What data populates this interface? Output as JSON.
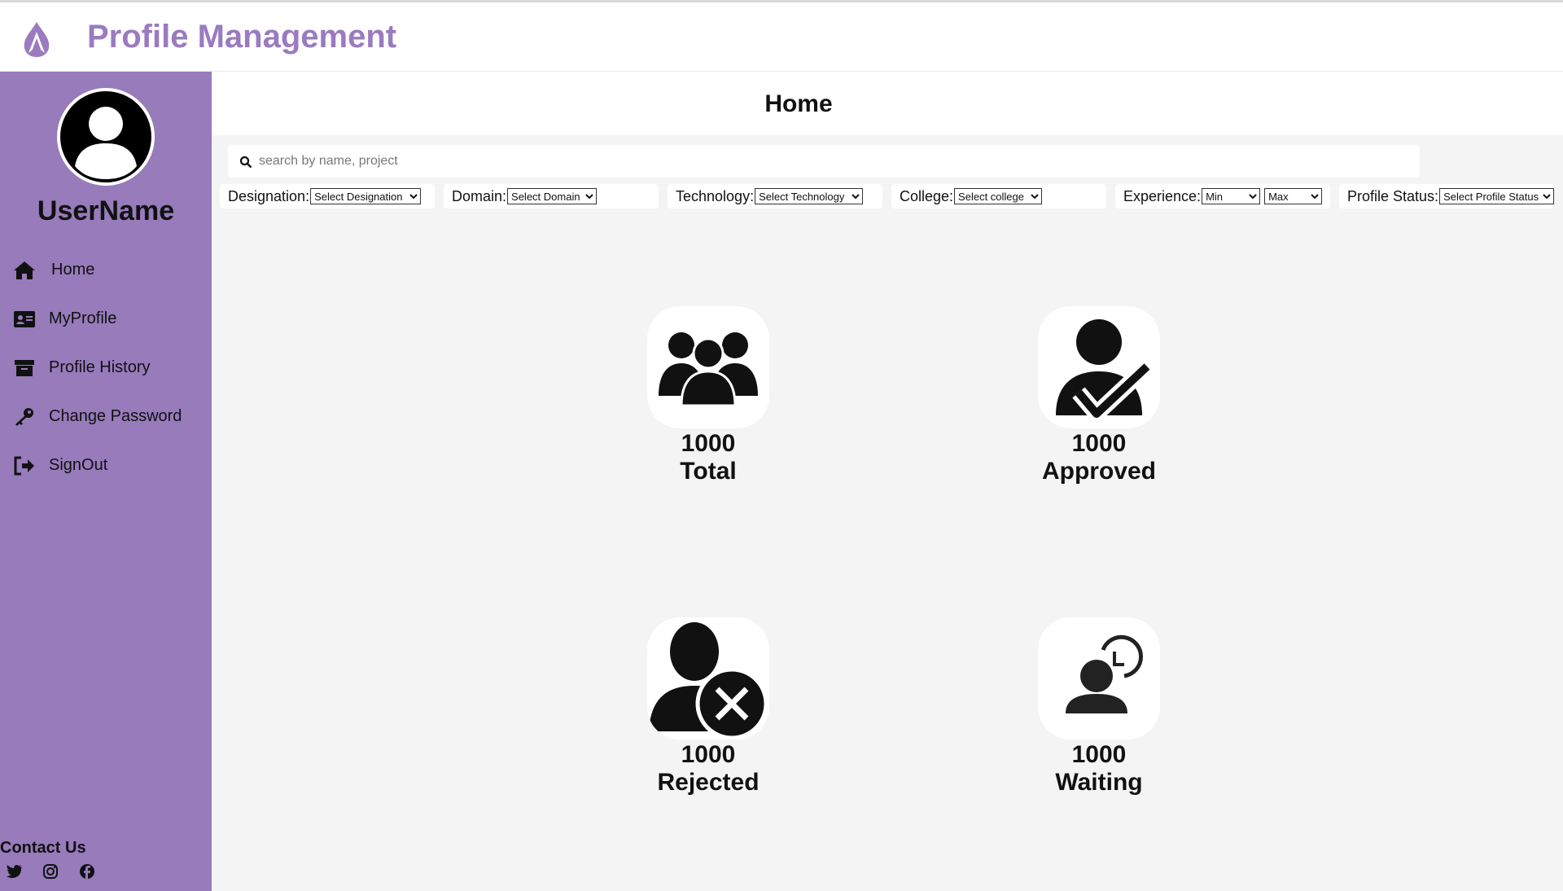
{
  "app": {
    "title": "Profile Management",
    "logo_icon": "flame-logo-icon",
    "brand_color": "#9a7bbf"
  },
  "sidebar": {
    "background": "#977bbb",
    "username": "UserName",
    "items": [
      {
        "label": "Home",
        "icon": "home-icon"
      },
      {
        "label": "MyProfile",
        "icon": "id-card-icon"
      },
      {
        "label": "Profile History",
        "icon": "archive-icon"
      },
      {
        "label": "Change Password",
        "icon": "key-icon"
      },
      {
        "label": "SignOut",
        "icon": "sign-out-icon"
      }
    ],
    "contact_label": "Contact Us",
    "social": [
      "twitter-icon",
      "instagram-icon",
      "facebook-icon"
    ]
  },
  "main": {
    "title": "Home",
    "search": {
      "placeholder": "search by name, project"
    },
    "filters": {
      "designation": {
        "label": "Designation:",
        "selected": "Select Designation"
      },
      "domain": {
        "label": "Domain:",
        "selected": "Select Domain"
      },
      "technology": {
        "label": "Technology:",
        "selected": "Select Technology"
      },
      "college": {
        "label": "College:",
        "selected": "Select college"
      },
      "experience": {
        "label": "Experience:",
        "min": "Min",
        "max": "Max"
      },
      "profile_status": {
        "label": "Profile Status:",
        "selected": "Select Profile Status"
      }
    },
    "cards": [
      {
        "count": "1000",
        "label": "Total",
        "icon": "users-group-icon"
      },
      {
        "count": "1000",
        "label": "Approved",
        "icon": "user-check-icon"
      },
      {
        "count": "1000",
        "label": "Rejected",
        "icon": "user-reject-icon"
      },
      {
        "count": "1000",
        "label": "Waiting",
        "icon": "user-clock-icon"
      }
    ]
  }
}
